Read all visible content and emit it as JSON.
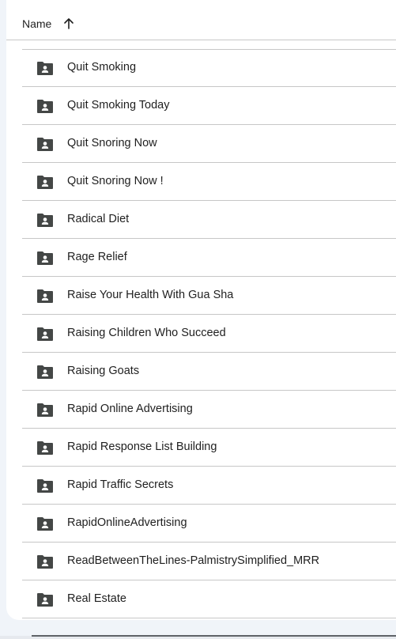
{
  "header": {
    "name_label": "Name",
    "sort_icon": "arrow-up-icon"
  },
  "folder_icon": "shared-folder-icon",
  "colors": {
    "text": "#1f1f1f",
    "icon": "#444746",
    "divider": "#c7c7c7",
    "background": "#ffffff"
  },
  "files": [
    {
      "name": "Quit Smoking"
    },
    {
      "name": "Quit Smoking Today"
    },
    {
      "name": "Quit Snoring Now"
    },
    {
      "name": "Quit Snoring Now !"
    },
    {
      "name": "Radical Diet"
    },
    {
      "name": "Rage Relief"
    },
    {
      "name": "Raise Your Health With Gua Sha"
    },
    {
      "name": "Raising Children Who Succeed"
    },
    {
      "name": "Raising Goats"
    },
    {
      "name": "Rapid Online Advertising"
    },
    {
      "name": "Rapid Response List Building"
    },
    {
      "name": "Rapid Traffic Secrets"
    },
    {
      "name": "RapidOnlineAdvertising"
    },
    {
      "name": "ReadBetweenTheLines-PalmistrySimplified_MRR"
    },
    {
      "name": "Real Estate"
    }
  ]
}
